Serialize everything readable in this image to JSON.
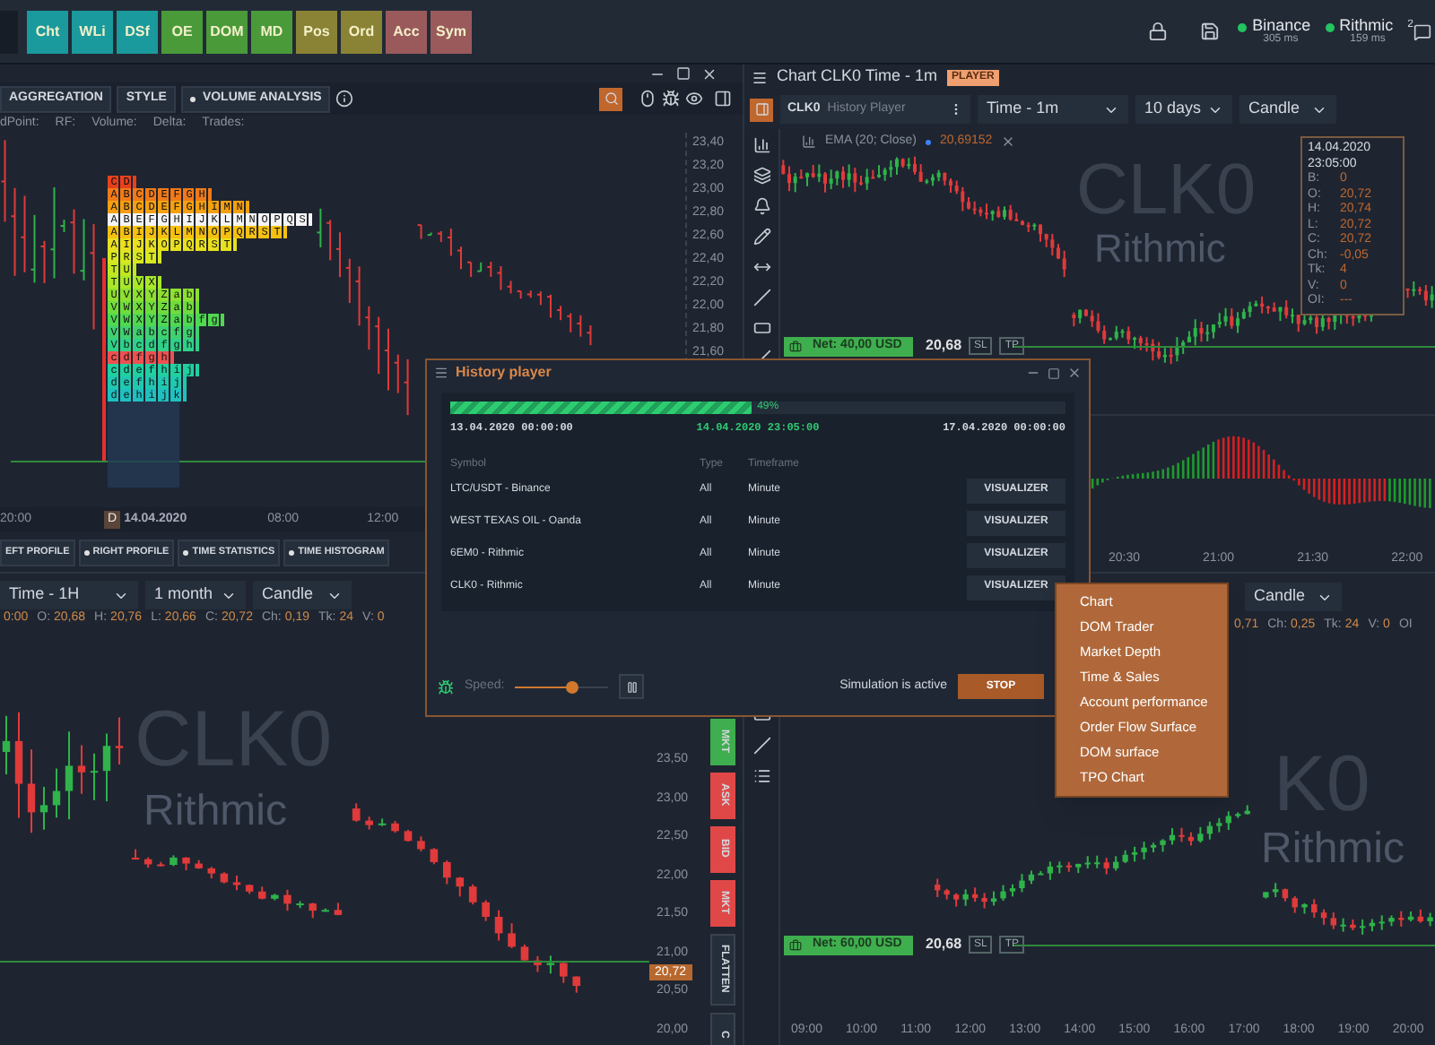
{
  "top_bar": {
    "buttons": [
      {
        "label": "Cht",
        "color": "#1a9a9c"
      },
      {
        "label": "WLi",
        "color": "#1a9a9c"
      },
      {
        "label": "DSf",
        "color": "#1a9a9c"
      },
      {
        "label": "OE",
        "color": "#4a9a3a"
      },
      {
        "label": "DOM",
        "color": "#4a9a3a"
      },
      {
        "label": "MD",
        "color": "#4a9a3a"
      },
      {
        "label": "Pos",
        "color": "#8a8234"
      },
      {
        "label": "Ord",
        "color": "#8a8234"
      },
      {
        "label": "Acc",
        "color": "#9a5a5c"
      },
      {
        "label": "Sym",
        "color": "#9a5a5c"
      }
    ],
    "connections": [
      {
        "name": "Binance",
        "latency": "305 ms",
        "color": "#22c55e"
      },
      {
        "name": "Rithmic",
        "latency": "159 ms",
        "color": "#22c55e"
      }
    ],
    "notification_count": "2"
  },
  "tpo_panel": {
    "toolbar": [
      {
        "label": "AGGREGATION",
        "dot": false
      },
      {
        "label": "STYLE",
        "dot": false
      },
      {
        "label": "VOLUME ANALYSIS",
        "dot": true
      }
    ],
    "info": [
      "dPoint:",
      "RF:",
      "Volume:",
      "Delta:",
      "Trades:"
    ],
    "price_axis": [
      "23,40",
      "23,20",
      "23,00",
      "22,80",
      "22,60",
      "22,40",
      "22,20",
      "22,00",
      "21,80",
      "21,60"
    ],
    "tpo_rows": [
      {
        "letters": "CD",
        "color": "#e8401c"
      },
      {
        "letters": "ABCDEFGH",
        "color": "#f07a1a"
      },
      {
        "letters": "ABCDEFGHIMN",
        "color": "#f5a010"
      },
      {
        "letters": "ABEFGHIJKLMNOPQS",
        "color": "#f4f4f4"
      },
      {
        "letters": "ABIJKLMNOPQRST",
        "color": "#f5c010"
      },
      {
        "letters": "AIJKOPQRST",
        "color": "#e8e020"
      },
      {
        "letters": "PRST",
        "color": "#d8e820"
      },
      {
        "letters": "TU",
        "color": "#c0e820"
      },
      {
        "letters": "TUVX",
        "color": "#a8e828"
      },
      {
        "letters": "UVXYZab",
        "color": "#8ee030"
      },
      {
        "letters": "VWXYZab",
        "color": "#70dc3c"
      },
      {
        "letters": "VWXYZabfg",
        "color": "#50d850"
      },
      {
        "letters": "VWabcfg",
        "color": "#40d070"
      },
      {
        "letters": "Vbcdfgh",
        "color": "#30d088"
      },
      {
        "letters": "cdfgh",
        "color": "#f05050"
      },
      {
        "letters": "cdefhij",
        "color": "#20d0a0"
      },
      {
        "letters": "defhij",
        "color": "#20c8b0"
      },
      {
        "letters": "dehijk",
        "color": "#20c0c0"
      }
    ],
    "time_axis": {
      "left": "20:00",
      "badge": "D",
      "date": "14.04.2020",
      "ticks": [
        "08:00",
        "12:00"
      ]
    },
    "bottom_buttons": [
      {
        "label": "EFT PROFILE",
        "dot": false
      },
      {
        "label": "RIGHT PROFILE",
        "dot": true
      },
      {
        "label": "TIME STATISTICS",
        "dot": true
      },
      {
        "label": "TIME HISTOGRAM",
        "dot": true
      }
    ]
  },
  "chart_1m": {
    "title": "Chart CLK0 Time - 1m",
    "badge": "PLAYER",
    "symbol": "CLK0",
    "source": "History Player",
    "selects": [
      "Time - 1m",
      "10 days",
      "Candle"
    ],
    "legend": {
      "name": "EMA (20; Close)",
      "value": "20,69152"
    },
    "watermark": [
      "CLK0",
      "Rithmic"
    ],
    "tooltip": {
      "date": "14.04.2020",
      "time": "23:05:00",
      "rows": [
        {
          "key": "B:",
          "value": "0"
        },
        {
          "key": "O:",
          "value": "20,72"
        },
        {
          "key": "H:",
          "value": "20,74"
        },
        {
          "key": "L:",
          "value": "20,72"
        },
        {
          "key": "C:",
          "value": "20,72"
        },
        {
          "key": "Ch:",
          "value": "-0,05"
        },
        {
          "key": "Tk:",
          "value": "4"
        },
        {
          "key": "V:",
          "value": "0"
        },
        {
          "key": "OI:",
          "value": "---"
        }
      ]
    },
    "net": {
      "label": "Net: 40,00 USD",
      "price": "20,68",
      "sl": "SL",
      "tp": "TP"
    },
    "time_axis": [
      "20:30",
      "21:00",
      "21:30",
      "22:00"
    ]
  },
  "chart_1h": {
    "selects": [
      "Time - 1H",
      "1 month",
      "Candle"
    ],
    "ohlc": [
      {
        "value": "0:00"
      },
      {
        "key": "O:",
        "value": "20,68"
      },
      {
        "key": "H:",
        "value": "20,76"
      },
      {
        "key": "L:",
        "value": "20,66"
      },
      {
        "key": "C:",
        "value": "20,72"
      },
      {
        "key": "Ch:",
        "value": "0,19"
      },
      {
        "key": "Tk:",
        "value": "24"
      },
      {
        "key": "V:",
        "value": "0"
      }
    ],
    "watermark": [
      "CLK0",
      "Rithmic"
    ],
    "price_axis": [
      "23,50",
      "23,00",
      "22,50",
      "22,00",
      "21,50",
      "21,00",
      "20,50",
      "20,00"
    ],
    "last_price": "20,72",
    "side_buttons": [
      {
        "label": "MKT",
        "kind": "buy"
      },
      {
        "label": "ASK",
        "kind": "sell"
      },
      {
        "label": "BID",
        "kind": "sell"
      },
      {
        "label": "MKT",
        "kind": "sell"
      },
      {
        "label": "FLATTEN",
        "kind": "neutral"
      },
      {
        "label": "C",
        "kind": "neutral"
      }
    ]
  },
  "chart_right": {
    "selects": [
      "Candle"
    ],
    "ohlc": [
      {
        "value": "0,71"
      },
      {
        "key": "Ch:",
        "value": "0,25"
      },
      {
        "key": "Tk:",
        "value": "24"
      },
      {
        "key": "V:",
        "value": "0"
      },
      {
        "key": "OI"
      }
    ],
    "watermark": [
      "K0",
      "Rithmic"
    ],
    "net": {
      "label": "Net: 60,00 USD",
      "price": "20,68",
      "sl": "SL",
      "tp": "TP"
    },
    "time_axis": [
      "09:00",
      "10:00",
      "11:00",
      "12:00",
      "13:00",
      "14:00",
      "15:00",
      "16:00",
      "17:00",
      "18:00",
      "19:00",
      "20:00"
    ]
  },
  "history_player": {
    "title": "History player",
    "progress": {
      "level": 0.49,
      "label": "49%"
    },
    "start": "13.04.2020 00:00:00",
    "current": "14.04.2020 23:05:00",
    "end": "17.04.2020 00:00:00",
    "columns": [
      "Symbol",
      "Type",
      "Timeframe"
    ],
    "rows": [
      {
        "symbol": "LTC/USDT - Binance",
        "type": "All",
        "timeframe": "Minute",
        "action": "VISUALIZER"
      },
      {
        "symbol": "WEST TEXAS OIL - Oanda",
        "type": "All",
        "timeframe": "Minute",
        "action": "VISUALIZER"
      },
      {
        "symbol": "6EM0 - Rithmic",
        "type": "All",
        "timeframe": "Minute",
        "action": "VISUALIZER"
      },
      {
        "symbol": "CLK0 - Rithmic",
        "type": "All",
        "timeframe": "Minute",
        "action": "VISUALIZER"
      }
    ],
    "speed": {
      "label": "Speed:",
      "level": 0.62
    },
    "status": "Simulation is active",
    "stop": "STOP"
  },
  "context_menu": [
    "Chart",
    "DOM Trader",
    "Market Depth",
    "Time & Sales",
    "Account performance",
    "Order Flow Surface",
    "DOM surface",
    "TPO Chart"
  ]
}
